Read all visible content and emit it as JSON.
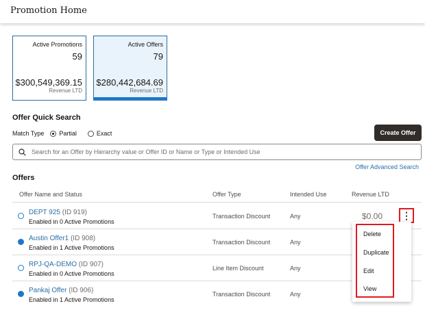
{
  "header": {
    "title": "Promotion Home"
  },
  "cards": [
    {
      "label": "Active Promotions",
      "count": "59",
      "amount": "$300,549,369.15",
      "sublabel": "Revenue LTD"
    },
    {
      "label": "Active Offers",
      "count": "79",
      "amount": "$280,442,684.69",
      "sublabel": "Revenue LTD"
    }
  ],
  "quick_search": {
    "heading": "Offer Quick Search",
    "match_type_label": "Match Type",
    "options": [
      "Partial",
      "Exact"
    ],
    "selected": "Partial",
    "create_button": "Create Offer",
    "placeholder": "Search for an Offer by Hierarchy value or Offer ID or Name or Type or Intended Use",
    "advanced_link": "Offer Advanced Search"
  },
  "offers": {
    "heading": "Offers",
    "columns": [
      "Offer Name and Status",
      "Offer Type",
      "Intended Use",
      "Revenue LTD"
    ],
    "rows": [
      {
        "name": "DEPT 925",
        "id": "(ID 919)",
        "status": "Enabled in 0 Active Promotions",
        "type": "Transaction Discount",
        "use": "Any",
        "revenue": "$0.00"
      },
      {
        "name": "Austin Offer1",
        "id": "(ID 908)",
        "status": "Enabled in 1 Active Promotions",
        "type": "Transaction Discount",
        "use": "Any",
        "revenue": ""
      },
      {
        "name": "RPJ-QA-DEMO",
        "id": "(ID 907)",
        "status": "Enabled in 0 Active Promotions",
        "type": "Line Item Discount",
        "use": "Any",
        "revenue": ""
      },
      {
        "name": "Pankaj Offer",
        "id": "(ID 906)",
        "status": "Enabled in 1 Active Promotions",
        "type": "Transaction Discount",
        "use": "Any",
        "revenue": ""
      }
    ]
  },
  "row_menu": {
    "items": [
      "Delete",
      "Duplicate",
      "Edit",
      "View"
    ]
  },
  "colors": {
    "accent": "#1f77c9",
    "link": "#2a6ea6",
    "highlight": "#e0191f",
    "button": "#312d2a"
  }
}
